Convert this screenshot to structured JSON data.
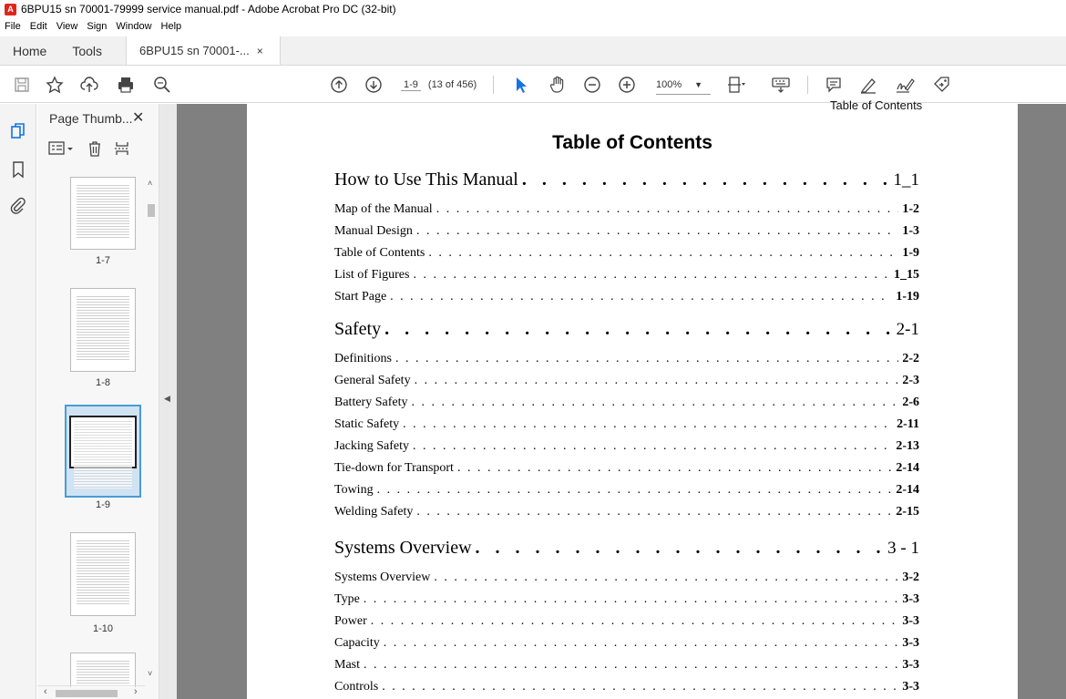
{
  "window": {
    "title": "6BPU15 sn 70001-79999 service manual.pdf - Adobe Acrobat Pro DC (32-bit)"
  },
  "menu": [
    "File",
    "Edit",
    "View",
    "Sign",
    "Window",
    "Help"
  ],
  "tabs": {
    "home": "Home",
    "tools": "Tools",
    "document": "6BPU15 sn 70001-...",
    "close": "×"
  },
  "toolbar": {
    "page_current": "1-9",
    "page_count": "(13 of 456)",
    "zoom": "100%"
  },
  "thumbnail_panel": {
    "title": "Page Thumb...",
    "close": "✕",
    "thumbnails": [
      {
        "label": "1-7"
      },
      {
        "label": "1-8"
      },
      {
        "label": "1-9",
        "selected": true
      },
      {
        "label": "1-10"
      }
    ]
  },
  "document": {
    "running_header": "Table of Contents",
    "title": "Table of Contents",
    "entries": [
      {
        "label": "How to Use This Manual",
        "page": "1_1",
        "level": "chapter"
      },
      {
        "label": "Map of the Manual",
        "page": "1-2",
        "level": "section"
      },
      {
        "label": "Manual Design",
        "page": "1-3",
        "level": "section"
      },
      {
        "label": "Table of Contents",
        "page": "1-9",
        "level": "section"
      },
      {
        "label": "List of Figures",
        "page": "1_15",
        "level": "section"
      },
      {
        "label": "Start Page",
        "page": "1-19",
        "level": "section"
      },
      {
        "label": "Safety",
        "page": "2-1",
        "level": "chapter"
      },
      {
        "label": "Definitions",
        "page": "2-2",
        "level": "section"
      },
      {
        "label": "General Safety",
        "page": "2-3",
        "level": "section"
      },
      {
        "label": "Battery Safety",
        "page": "2-6",
        "level": "section"
      },
      {
        "label": "Static Safety",
        "page": "2-11",
        "level": "section"
      },
      {
        "label": "Jacking Safety",
        "page": "2-13",
        "level": "section"
      },
      {
        "label": "Tie-down for Transport",
        "page": "2-14",
        "level": "section"
      },
      {
        "label": "Towing",
        "page": "2-14",
        "level": "section"
      },
      {
        "label": "Welding Safety",
        "page": "2-15",
        "level": "section"
      },
      {
        "label": "Systems Overview",
        "page": "3 - 1",
        "level": "chapter"
      },
      {
        "label": "Systems Overview",
        "page": "3-2",
        "level": "section"
      },
      {
        "label": "Type",
        "page": "3-3",
        "level": "section"
      },
      {
        "label": "Power",
        "page": "3-3",
        "level": "section"
      },
      {
        "label": "Capacity",
        "page": "3-3",
        "level": "section"
      },
      {
        "label": "Mast",
        "page": "3-3",
        "level": "section"
      },
      {
        "label": "Controls",
        "page": "3-3",
        "level": "section"
      }
    ]
  },
  "colors": {
    "doc_background": "#808080",
    "selection": "#4a9bd6",
    "cursor_tool": "#1473e6"
  }
}
